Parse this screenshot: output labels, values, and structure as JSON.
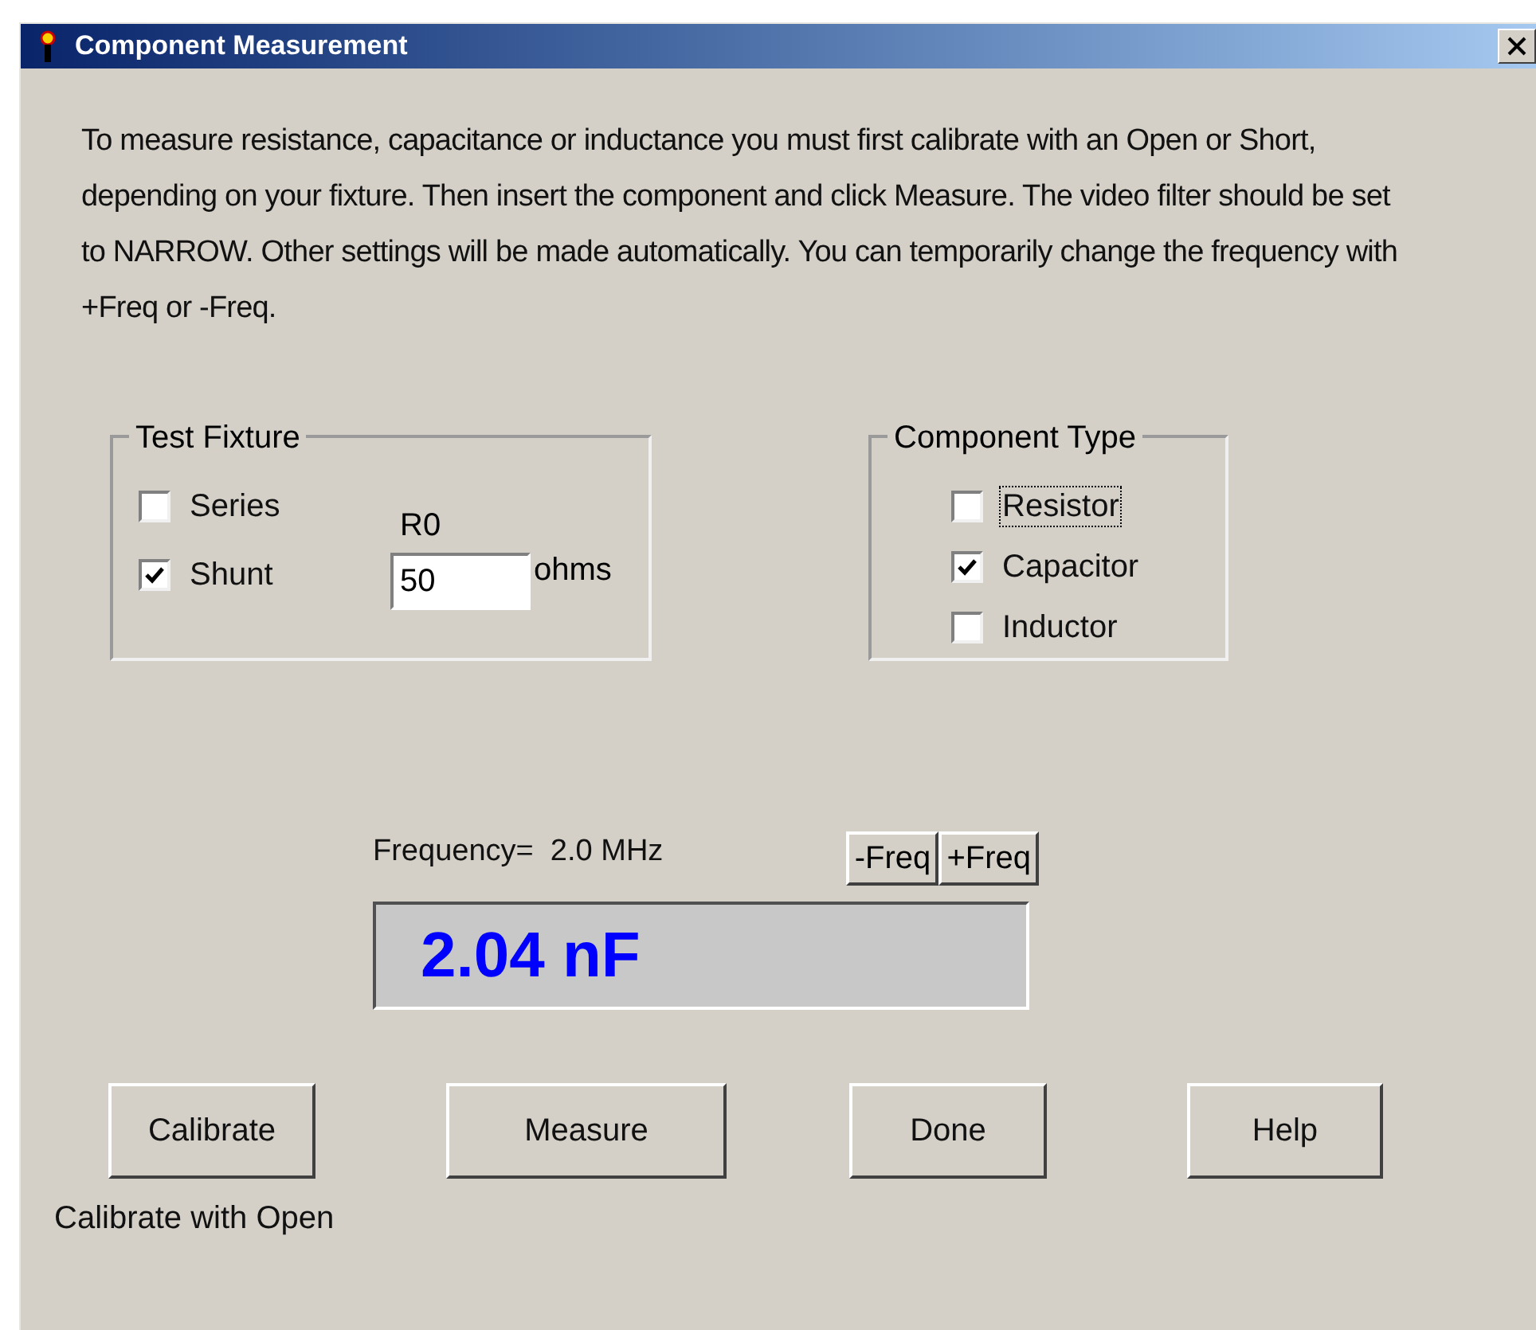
{
  "window": {
    "title": "Component Measurement"
  },
  "description": "To measure resistance, capacitance or inductance you must first calibrate with an Open or Short, depending on your fixture. Then insert the component and click Measure. The video filter should be set to NARROW. Other settings will be made automatically. You can temporarily change the frequency with +Freq or -Freq.",
  "test_fixture": {
    "title": "Test Fixture",
    "options": [
      {
        "label": "Series",
        "checked": false
      },
      {
        "label": "Shunt",
        "checked": true
      }
    ],
    "r0_label": "R0",
    "r0_value": "50",
    "r0_unit": "ohms"
  },
  "component_type": {
    "title": "Component Type",
    "options": [
      {
        "label": "Resistor",
        "checked": false,
        "focused": true
      },
      {
        "label": "Capacitor",
        "checked": true,
        "focused": false
      },
      {
        "label": "Inductor",
        "checked": false,
        "focused": false
      }
    ]
  },
  "frequency": {
    "label": "Frequency=",
    "value": "2.0 MHz"
  },
  "freq_buttons": [
    "-Freq",
    "+Freq"
  ],
  "reading": "2.04 nF",
  "buttons": [
    "Calibrate",
    "Measure",
    "Done",
    "Help"
  ],
  "calibrate_hint": "Calibrate with Open"
}
